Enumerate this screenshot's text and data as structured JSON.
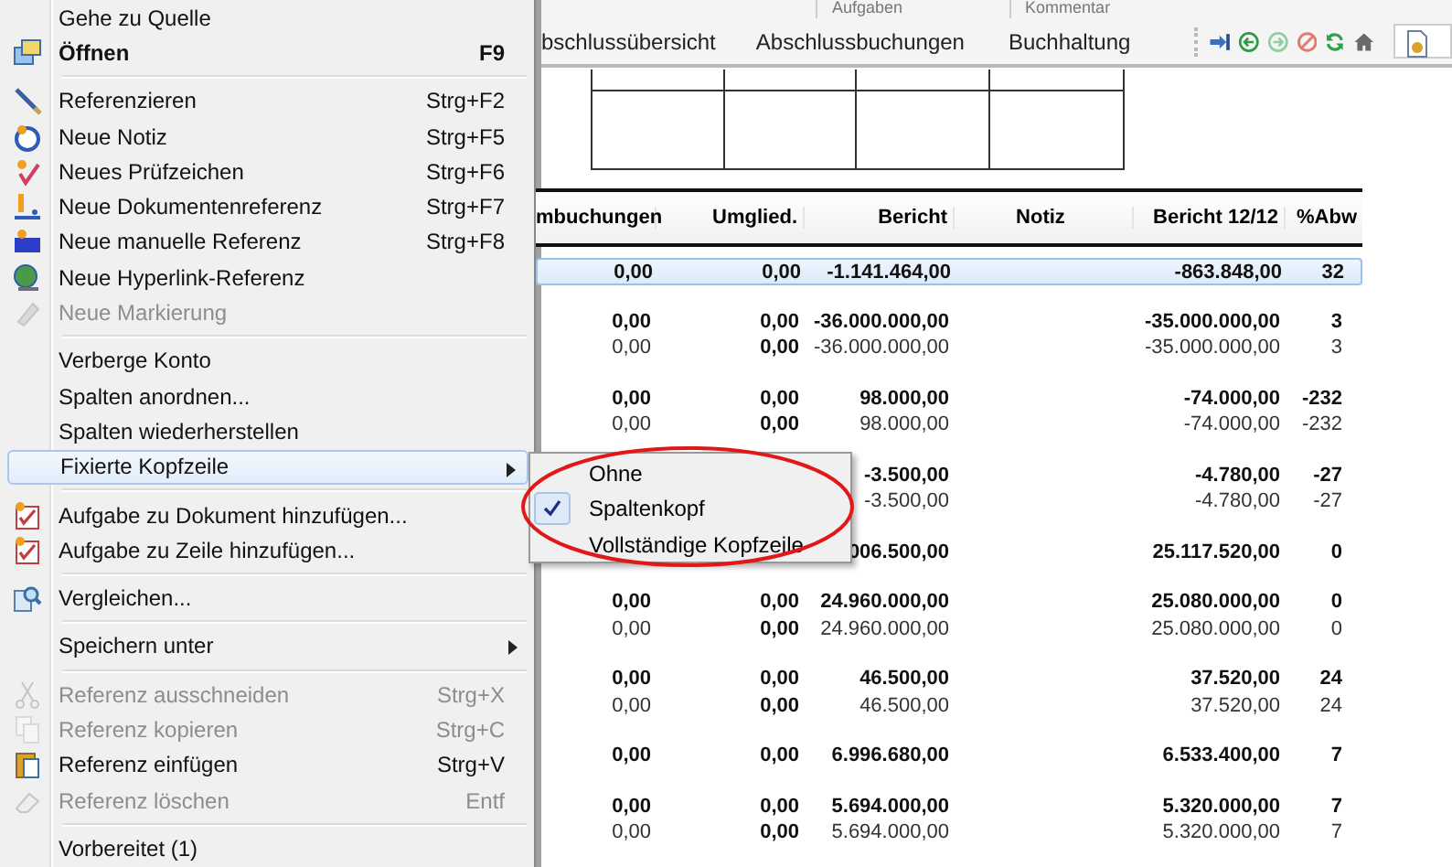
{
  "ribbon": {
    "groups": [
      "Aufgaben",
      "Kommentar"
    ]
  },
  "tabs": [
    {
      "label": "bschlussübersicht",
      "selected": false
    },
    {
      "label": "Abschlussbuchungen",
      "selected": false
    },
    {
      "label": "Buchhaltung",
      "selected": false
    }
  ],
  "table": {
    "columns": [
      "mbuchungen",
      "Umglied.",
      "Bericht",
      "Notiz",
      "Bericht 12/12",
      "%Abw"
    ],
    "groups": [
      {
        "rows": [
          {
            "kind": "total",
            "selected": true,
            "umbuchungen": "0,00",
            "umglied": "0,00",
            "bericht": "-1.141.464,00",
            "bericht_12_12": "-863.848,00",
            "abw": "32"
          }
        ]
      },
      {
        "rows": [
          {
            "kind": "total",
            "selected": false,
            "umbuchungen": "0,00",
            "umglied": "0,00",
            "bericht": "-36.000.000,00",
            "bericht_12_12": "-35.000.000,00",
            "abw": "3"
          },
          {
            "kind": "detail",
            "selected": false,
            "umbuchungen": "0,00",
            "umglied": "0,00",
            "bericht": "-36.000.000,00",
            "bericht_12_12": "-35.000.000,00",
            "abw": "3"
          }
        ]
      },
      {
        "rows": [
          {
            "kind": "total",
            "selected": false,
            "umbuchungen": "0,00",
            "umglied": "0,00",
            "bericht": "98.000,00",
            "bericht_12_12": "-74.000,00",
            "abw": "-232"
          },
          {
            "kind": "detail",
            "selected": false,
            "umbuchungen": "0,00",
            "umglied": "0,00",
            "bericht": "98.000,00",
            "bericht_12_12": "-74.000,00",
            "abw": "-232"
          }
        ]
      },
      {
        "rows": [
          {
            "kind": "total",
            "selected": false,
            "bericht": "-3.500,00",
            "bericht_12_12": "-4.780,00",
            "abw": "-27"
          },
          {
            "kind": "detail",
            "selected": false,
            "bericht": "-3.500,00",
            "bericht_12_12": "-4.780,00",
            "abw": "-27"
          }
        ]
      },
      {
        "rows": [
          {
            "kind": "total",
            "selected": false,
            "bericht": "006.500,00",
            "bericht_12_12": "25.117.520,00",
            "abw": "0"
          }
        ]
      },
      {
        "rows": [
          {
            "kind": "total",
            "selected": false,
            "umbuchungen": "0,00",
            "umglied": "0,00",
            "bericht": "24.960.000,00",
            "bericht_12_12": "25.080.000,00",
            "abw": "0"
          },
          {
            "kind": "detail",
            "selected": false,
            "umbuchungen": "0,00",
            "umglied": "0,00",
            "bericht": "24.960.000,00",
            "bericht_12_12": "25.080.000,00",
            "abw": "0"
          }
        ]
      },
      {
        "rows": [
          {
            "kind": "total",
            "selected": false,
            "umbuchungen": "0,00",
            "umglied": "0,00",
            "bericht": "46.500,00",
            "bericht_12_12": "37.520,00",
            "abw": "24"
          },
          {
            "kind": "detail",
            "selected": false,
            "umbuchungen": "0,00",
            "umglied": "0,00",
            "bericht": "46.500,00",
            "bericht_12_12": "37.520,00",
            "abw": "24"
          }
        ]
      },
      {
        "rows": [
          {
            "kind": "total",
            "selected": false,
            "umbuchungen": "0,00",
            "umglied": "0,00",
            "bericht": "6.996.680,00",
            "bericht_12_12": "6.533.400,00",
            "abw": "7"
          }
        ]
      },
      {
        "rows": [
          {
            "kind": "total",
            "selected": false,
            "umbuchungen": "0,00",
            "umglied": "0,00",
            "bericht": "5.694.000,00",
            "bericht_12_12": "5.320.000,00",
            "abw": "7"
          },
          {
            "kind": "detail",
            "selected": false,
            "umbuchungen": "0,00",
            "umglied": "0,00",
            "bericht": "5.694.000,00",
            "bericht_12_12": "5.320.000,00",
            "abw": "7"
          }
        ]
      }
    ]
  },
  "context_menu": {
    "items": [
      {
        "kind": "item",
        "label": "Gehe zu Quelle",
        "selected": false,
        "disabled": false,
        "default": false,
        "has_submenu": false
      },
      {
        "kind": "item",
        "label": "Öffnen",
        "shortcut": "F9",
        "selected": false,
        "disabled": false,
        "default": true,
        "has_submenu": false
      },
      {
        "kind": "separator"
      },
      {
        "kind": "item",
        "label": "Referenzieren",
        "shortcut": "Strg+F2",
        "selected": false,
        "disabled": false,
        "default": false,
        "has_submenu": false
      },
      {
        "kind": "item",
        "label": "Neue Notiz",
        "shortcut": "Strg+F5",
        "selected": false,
        "disabled": false,
        "default": false,
        "has_submenu": false
      },
      {
        "kind": "item",
        "label": "Neues Prüfzeichen",
        "shortcut": "Strg+F6",
        "selected": false,
        "disabled": false,
        "default": false,
        "has_submenu": false
      },
      {
        "kind": "item",
        "label": "Neue Dokumentenreferenz",
        "shortcut": "Strg+F7",
        "selected": false,
        "disabled": false,
        "default": false,
        "has_submenu": false
      },
      {
        "kind": "item",
        "label": "Neue manuelle Referenz",
        "shortcut": "Strg+F8",
        "selected": false,
        "disabled": false,
        "default": false,
        "has_submenu": false
      },
      {
        "kind": "item",
        "label": "Neue Hyperlink-Referenz",
        "selected": false,
        "disabled": false,
        "default": false,
        "has_submenu": false
      },
      {
        "kind": "item",
        "label": "Neue Markierung",
        "selected": false,
        "disabled": true,
        "default": false,
        "has_submenu": false
      },
      {
        "kind": "separator"
      },
      {
        "kind": "item",
        "label": "Verberge Konto",
        "selected": false,
        "disabled": false,
        "default": false,
        "has_submenu": false
      },
      {
        "kind": "item",
        "label": "Spalten anordnen...",
        "selected": false,
        "disabled": false,
        "default": false,
        "has_submenu": false
      },
      {
        "kind": "item",
        "label": "Spalten wiederherstellen",
        "selected": false,
        "disabled": false,
        "default": false,
        "has_submenu": false
      },
      {
        "kind": "item",
        "label": "Fixierte Kopfzeile",
        "selected": true,
        "disabled": false,
        "default": false,
        "has_submenu": true
      },
      {
        "kind": "separator"
      },
      {
        "kind": "item",
        "label": "Aufgabe zu Dokument hinzufügen...",
        "selected": false,
        "disabled": false,
        "default": false,
        "has_submenu": false
      },
      {
        "kind": "item",
        "label": "Aufgabe zu Zeile hinzufügen...",
        "selected": false,
        "disabled": false,
        "default": false,
        "has_submenu": false
      },
      {
        "kind": "separator"
      },
      {
        "kind": "item",
        "label": "Vergleichen...",
        "selected": false,
        "disabled": false,
        "default": false,
        "has_submenu": false
      },
      {
        "kind": "separator"
      },
      {
        "kind": "item",
        "label": "Speichern unter",
        "selected": false,
        "disabled": false,
        "default": false,
        "has_submenu": true
      },
      {
        "kind": "separator"
      },
      {
        "kind": "item",
        "label": "Referenz ausschneiden",
        "shortcut": "Strg+X",
        "selected": false,
        "disabled": true,
        "default": false,
        "has_submenu": false
      },
      {
        "kind": "item",
        "label": "Referenz kopieren",
        "shortcut": "Strg+C",
        "selected": false,
        "disabled": true,
        "default": false,
        "has_submenu": false
      },
      {
        "kind": "item",
        "label": "Referenz einfügen",
        "shortcut": "Strg+V",
        "selected": false,
        "disabled": false,
        "default": false,
        "has_submenu": false
      },
      {
        "kind": "item",
        "label": "Referenz löschen",
        "shortcut": "Entf",
        "selected": false,
        "disabled": true,
        "default": false,
        "has_submenu": false
      },
      {
        "kind": "separator"
      },
      {
        "kind": "item",
        "label": "Vorbereitet (1)",
        "selected": false,
        "disabled": false,
        "default": false,
        "has_submenu": false
      }
    ]
  },
  "submenu": {
    "items": [
      {
        "label": "Ohne",
        "checked": false
      },
      {
        "label": "Spaltenkopf",
        "checked": true
      },
      {
        "label": "Vollständige Kopfzeile",
        "checked": false
      }
    ]
  }
}
